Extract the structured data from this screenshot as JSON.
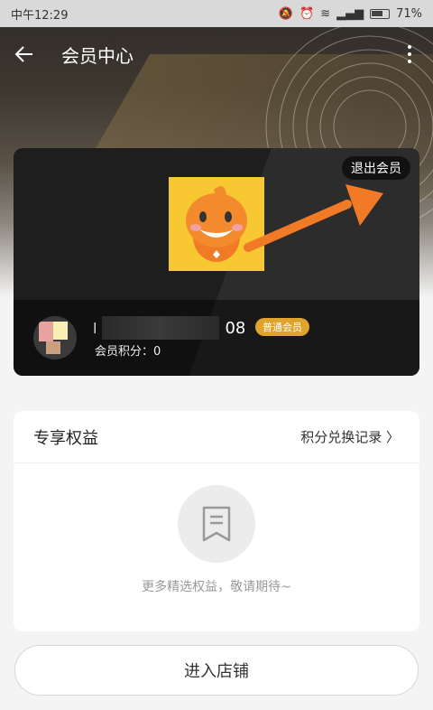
{
  "status_bar": {
    "time": "中午12:29",
    "battery": "71%"
  },
  "header": {
    "title": "会员中心"
  },
  "card": {
    "exit_label": "退出会员",
    "username_prefix": "l",
    "username_suffix": "08",
    "level": "普通会员",
    "points_label": "会员积分：0"
  },
  "benefits": {
    "title": "专享权益",
    "link": "积分兑换记录 〉",
    "empty_text": "更多精选权益，敬请期待~"
  },
  "store_button": "进入店铺",
  "colors": {
    "level_badge": "#e0a32b",
    "arrow": "#f07a26",
    "mascot_bg": "#f7c831"
  }
}
